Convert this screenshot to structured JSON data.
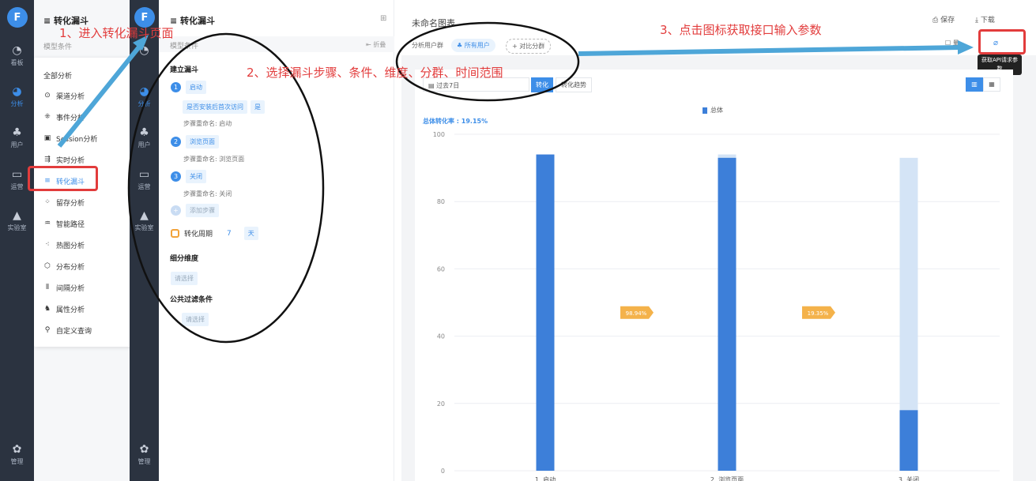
{
  "sidebar_left": {
    "logo": "F",
    "items": [
      {
        "label": "看板",
        "icon": "gauge-icon"
      },
      {
        "label": "分析",
        "icon": "pie-icon"
      },
      {
        "label": "用户",
        "icon": "users-icon"
      },
      {
        "label": "运营",
        "icon": "chart-icon"
      },
      {
        "label": "实验室",
        "icon": "flask-icon"
      },
      {
        "label": "管理",
        "icon": "gear-icon"
      }
    ]
  },
  "panel1": {
    "title": "转化漏斗",
    "subtitle": "模型条件"
  },
  "menu": {
    "header": "全部分析",
    "items": [
      "渠道分析",
      "事件分析",
      "Session分析",
      "实时分析",
      "转化漏斗",
      "留存分析",
      "智能路径",
      "热图分析",
      "分布分析",
      "间隔分析",
      "属性分析",
      "自定义查询"
    ],
    "selected": "转化漏斗"
  },
  "panel2": {
    "title": "转化漏斗",
    "subtitle": "模型条件",
    "compare_label": "折叠",
    "section_build": "建立漏斗",
    "steps": [
      {
        "num": "1",
        "name": "启动",
        "filter": "是否安装后首次访问",
        "filter_val": "是",
        "rename": "步骤重命名: 启动"
      },
      {
        "num": "2",
        "name": "浏览页面",
        "rename": "步骤重命名: 浏览页面"
      },
      {
        "num": "3",
        "name": "关闭",
        "rename": "步骤重命名: 关闭"
      }
    ],
    "add_step": "添加步骤",
    "period_label": "转化周期",
    "period_value": "7",
    "period_unit": "天",
    "section_dim": "细分维度",
    "dim_placeholder": "请选择",
    "section_filter": "公共过滤条件",
    "filter_placeholder": "请选择"
  },
  "main": {
    "chart_title": "未命名图表",
    "save": "保存",
    "download": "下载",
    "group_label": "分析用户群",
    "group_value": "所有用户",
    "compare": "+ 对比分群",
    "range": "过去7日",
    "tab_conv": "转化",
    "tab_trend": "转化趋势",
    "tooltip": "获取API请求参数",
    "legend": "总体",
    "rate": "总体转化率 : 19.15%"
  },
  "chart_data": {
    "type": "bar",
    "categories": [
      "1. 启动",
      "2. 浏览页面",
      "3. 关闭"
    ],
    "series": [
      {
        "name": "总体",
        "values": [
          94,
          93,
          18
        ]
      }
    ],
    "ghost": [
      null,
      94,
      93
    ],
    "conversion_labels": [
      "98.94%",
      "19.35%"
    ],
    "ylim": [
      0,
      100
    ],
    "yticks": [
      0,
      20,
      40,
      60,
      80,
      100
    ]
  },
  "annotations": {
    "a1": "1、进入转化漏斗页面",
    "a2": "2、选择漏斗步骤、条件、维度、分群、时间范围",
    "a3": "3、点击图标获取接口输入参数"
  }
}
